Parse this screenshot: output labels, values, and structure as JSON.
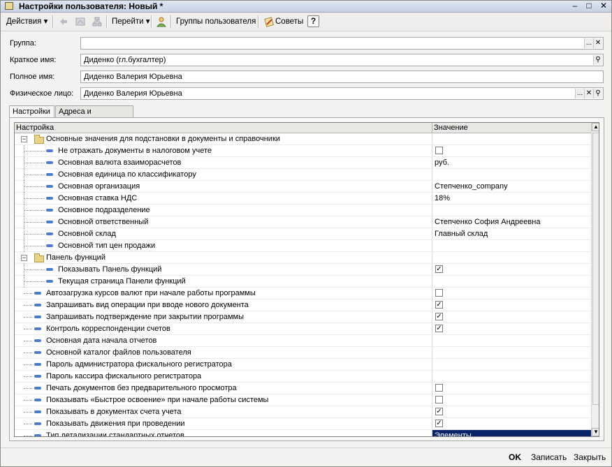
{
  "window": {
    "title": "Настройки пользователя: Новый *",
    "minimize": "–",
    "maximize": "□",
    "close": "✕"
  },
  "toolbar": {
    "actions": "Действия",
    "goto": "Перейти",
    "groups": "Группы пользователя",
    "tips": "Советы",
    "help": "?",
    "dropdown_arrow": "▾"
  },
  "form": {
    "group": {
      "label": "Группа:",
      "value": ""
    },
    "short_name": {
      "label": "Краткое имя:",
      "value": "Диденко (гл.бухгалтер)"
    },
    "full_name": {
      "label": "Полное имя:",
      "value": "Диденко Валерия Юрьевна"
    },
    "person": {
      "label": "Физическое лицо:",
      "value": "Диденко Валерия Юрьевна"
    },
    "btn_select": "...",
    "btn_clear": "✕",
    "btn_search": "⚲"
  },
  "tabs": [
    {
      "label": "Настройки"
    },
    {
      "label": "Адреса и телефоны"
    }
  ],
  "grid": {
    "col_setting": "Настройка",
    "col_value": "Значение",
    "scroll_up": "▲",
    "scroll_down": "▼",
    "rows": [
      {
        "name": "Основные значения для подстановки в документы и справочники",
        "level": 0,
        "group": true,
        "value": ""
      },
      {
        "name": "Не отражать документы в налоговом учете",
        "level": 1,
        "checkbox": true,
        "checked": false
      },
      {
        "name": "Основная валюта взаиморасчетов",
        "level": 1,
        "value": "руб."
      },
      {
        "name": "Основная единица по классификатору",
        "level": 1,
        "value": ""
      },
      {
        "name": "Основная организация",
        "level": 1,
        "value": "Степченко_company"
      },
      {
        "name": "Основная ставка НДС",
        "level": 1,
        "value": "18%"
      },
      {
        "name": "Основное подразделение",
        "level": 1,
        "value": ""
      },
      {
        "name": "Основной ответственный",
        "level": 1,
        "value": "Степченко София Андреевна"
      },
      {
        "name": "Основной склад",
        "level": 1,
        "value": "Главный склад"
      },
      {
        "name": "Основной тип цен продажи",
        "level": 1,
        "value": ""
      },
      {
        "name": "Панель функций",
        "level": 0,
        "group": true,
        "value": ""
      },
      {
        "name": "Показывать Панель функций",
        "level": 1,
        "checkbox": true,
        "checked": true
      },
      {
        "name": "Текущая страница Панели функций",
        "level": 1,
        "value": ""
      },
      {
        "name": "Автозагрузка курсов валют при начале работы программы",
        "level": 0,
        "checkbox": true,
        "checked": false
      },
      {
        "name": "Запрашивать вид операции при вводе нового документа",
        "level": 0,
        "checkbox": true,
        "checked": true
      },
      {
        "name": "Запрашивать подтверждение при закрытии программы",
        "level": 0,
        "checkbox": true,
        "checked": true
      },
      {
        "name": "Контроль корреспонденции счетов",
        "level": 0,
        "checkbox": true,
        "checked": true
      },
      {
        "name": "Основная дата начала отчетов",
        "level": 0,
        "value": ""
      },
      {
        "name": "Основной каталог файлов пользователя",
        "level": 0,
        "value": ""
      },
      {
        "name": "Пароль администратора фискального регистратора",
        "level": 0,
        "value": ""
      },
      {
        "name": "Пароль кассира фискального регистратора",
        "level": 0,
        "value": ""
      },
      {
        "name": "Печать документов без предварительного просмотра",
        "level": 0,
        "checkbox": true,
        "checked": false
      },
      {
        "name": "Показывать «Быстрое освоение» при начале работы системы",
        "level": 0,
        "checkbox": true,
        "checked": false
      },
      {
        "name": "Показывать в документах счета учета",
        "level": 0,
        "checkbox": true,
        "checked": true
      },
      {
        "name": "Показывать движения при проведении",
        "level": 0,
        "checkbox": true,
        "checked": true
      },
      {
        "name": "Тип детализации стандартных отчетов",
        "level": 0,
        "value": "Элементы",
        "selected": true
      }
    ]
  },
  "footer": {
    "ok": "OK",
    "save": "Записать",
    "close": "Закрыть"
  },
  "colors": {
    "selection": "#0a246a",
    "titlebar": "#c7d2e4"
  }
}
